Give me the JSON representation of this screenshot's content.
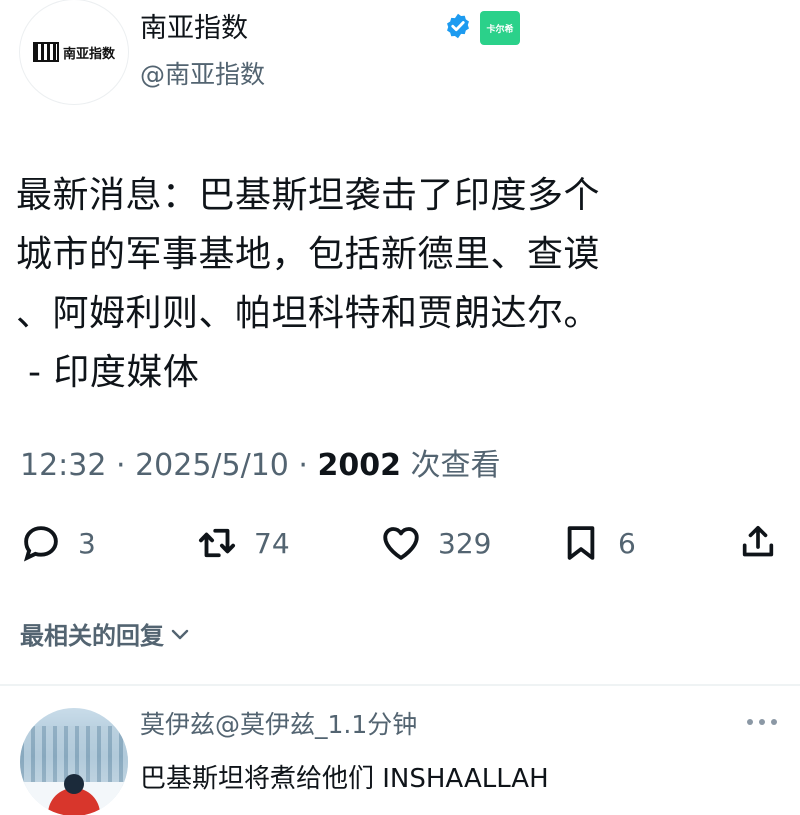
{
  "header": {
    "avatar_text": "南亚指数",
    "display_name": "南亚指数",
    "handle": "@南亚指数",
    "affiliate_badge_text": "卡尔希",
    "verified_color": "#1d9bf0"
  },
  "tweet": {
    "text": "最新消息：巴基斯坦袭击了印度多个\n城市的军事基地，包括新德里、查谟\n、阿姆利则、帕坦科特和贾朗达尔。\n - 印度媒体",
    "time": "12:32 · 2025/5/10 · ",
    "views_count": "2002",
    "views_label": " 次查看"
  },
  "actions": {
    "replies": "3",
    "retweets": "74",
    "likes": "329",
    "bookmarks": "6"
  },
  "replies_sort_label": "最相关的回复",
  "reply": {
    "header": "莫伊兹@莫伊兹_1.1分钟",
    "text": "巴基斯坦将煮给他们 INSHAALLAH"
  },
  "colors": {
    "text_primary": "#0f1419",
    "text_secondary": "#536471",
    "accent": "#1d9bf0"
  }
}
